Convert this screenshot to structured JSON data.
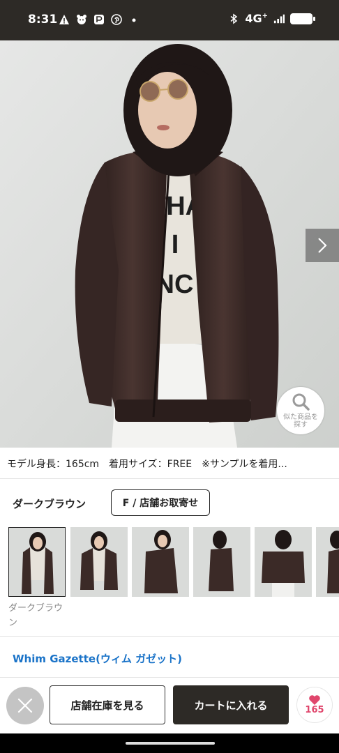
{
  "status_bar": {
    "time": "8:31",
    "network": "4G",
    "network_suffix": "+",
    "left_icons": [
      "warning-icon",
      "cat-app-icon",
      "pay-app-icon",
      "pinterest-icon",
      "dot-icon"
    ],
    "right_icons": [
      "bluetooth-icon",
      "signal-icon",
      "battery-icon"
    ]
  },
  "hero": {
    "image": "model wearing dark brown leather jacket",
    "shirt_print_lines": [
      "THA",
      "T I",
      "INC"
    ],
    "next_icon": "chevron-right-icon",
    "similar_button": {
      "icon": "search-icon",
      "label": "似た商品を\n探す"
    }
  },
  "model_info": "モデル身長：165cm　着用サイズ：FREE　※サンプルを着用...",
  "variant": {
    "color_name": "ダークブラウン",
    "size_chip": "F / 店舗お取寄せ",
    "thumbnail_caption": "ダークブラウン",
    "thumbnail_count": 6
  },
  "brand": {
    "link_text": "Whim Gazette(ウィム ガゼット)"
  },
  "actions": {
    "close_icon": "close-icon",
    "store_stock": "店舗在庫を見る",
    "add_to_cart": "カートに入れる",
    "favorite_icon": "heart-icon",
    "favorite_count": "165"
  },
  "colors": {
    "dark": "#2d2a26",
    "link": "#1a73c8",
    "favorite": "#e0466c",
    "jacket": "#3a2a27"
  }
}
